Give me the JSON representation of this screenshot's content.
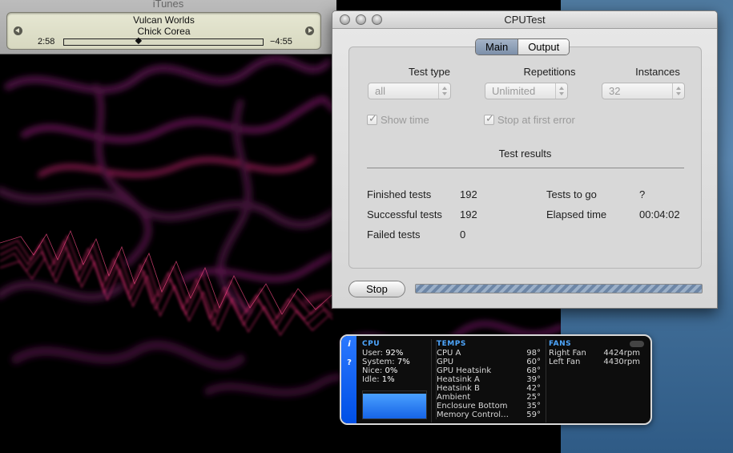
{
  "itunes": {
    "window_title": "iTunes",
    "track_title": "Vulcan Worlds",
    "artist": "Chick Corea",
    "elapsed": "2:58",
    "remaining": "−4:55",
    "progress_fraction": 0.37
  },
  "cputest": {
    "title": "CPUTest",
    "tabs": [
      "Main",
      "Output"
    ],
    "active_tab": "Main",
    "test_type": {
      "label": "Test type",
      "value": "all"
    },
    "repetitions": {
      "label": "Repetitions",
      "value": "Unlimited"
    },
    "instances": {
      "label": "Instances",
      "value": "32"
    },
    "show_time": {
      "label": "Show time",
      "checked": true
    },
    "stop_at_first_error": {
      "label": "Stop at first error",
      "checked": true
    },
    "results_heading": "Test results",
    "finished_tests": {
      "label": "Finished tests",
      "value": "192"
    },
    "successful_tests": {
      "label": "Successful tests",
      "value": "192"
    },
    "failed_tests": {
      "label": "Failed tests",
      "value": "0"
    },
    "tests_to_go": {
      "label": "Tests to go",
      "value": "?"
    },
    "elapsed_time": {
      "label": "Elapsed time",
      "value": "00:04:02"
    },
    "stop_label": "Stop"
  },
  "istat": {
    "cpu": {
      "title": "CPU",
      "user": {
        "label": "User:",
        "value": "92%"
      },
      "system": {
        "label": "System:",
        "value": "7%"
      },
      "nice": {
        "label": "Nice:",
        "value": "0%"
      },
      "idle": {
        "label": "Idle:",
        "value": "1%"
      },
      "load_fraction": 0.92
    },
    "temps": {
      "title": "TEMPS",
      "rows": [
        {
          "name": "CPU A",
          "value": "98°"
        },
        {
          "name": "GPU",
          "value": "60°"
        },
        {
          "name": "GPU Heatsink",
          "value": "68°"
        },
        {
          "name": "Heatsink A",
          "value": "39°"
        },
        {
          "name": "Heatsink B",
          "value": "42°"
        },
        {
          "name": "Ambient",
          "value": "25°"
        },
        {
          "name": "Enclosure Bottom",
          "value": "35°"
        },
        {
          "name": "Memory Control…",
          "value": "59°"
        }
      ]
    },
    "fans": {
      "title": "FANS",
      "rows": [
        {
          "name": "Right Fan",
          "value": "4424rpm"
        },
        {
          "name": "Left Fan",
          "value": "4430rpm"
        }
      ]
    }
  },
  "colors": {
    "visualizer_magenta": "#c1266f",
    "visualizer_purple": "#4a1240",
    "istat_blue": "#2a78ff",
    "desktop_blue": "#4f7aa0"
  }
}
